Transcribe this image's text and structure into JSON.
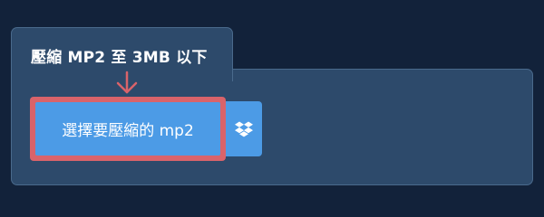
{
  "panel": {
    "title": "壓縮 MP2 至 3MB 以下"
  },
  "upload": {
    "button_label": "選擇要壓縮的 mp2"
  },
  "icons": {
    "arrow": "arrow-down-icon",
    "dropbox": "dropbox-icon"
  },
  "colors": {
    "background": "#12223a",
    "panel": "#2d4a6b",
    "button": "#4c9be6",
    "highlight": "#d9636a"
  }
}
